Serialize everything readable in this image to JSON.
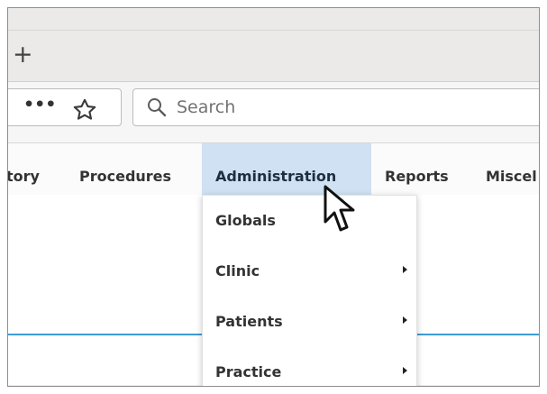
{
  "browser": {
    "new_tab_label": "+",
    "more_label": "•••",
    "search": {
      "placeholder": "Search",
      "value": ""
    }
  },
  "nav": {
    "items": [
      {
        "label": "tory"
      },
      {
        "label": "Procedures"
      },
      {
        "label": "Administration",
        "active": true
      },
      {
        "label": "Reports"
      },
      {
        "label": "Miscel"
      }
    ]
  },
  "menu": {
    "items": [
      {
        "label": "Globals",
        "has_submenu": false
      },
      {
        "label": "Clinic",
        "has_submenu": true
      },
      {
        "label": "Patients",
        "has_submenu": true
      },
      {
        "label": "Practice",
        "has_submenu": true
      }
    ]
  },
  "colors": {
    "active_nav_bg": "#cfe1f3",
    "accent_rule": "#3d9bd5",
    "text": "#333333"
  },
  "icons": {
    "more": "ellipsis-icon",
    "bookmark": "star-icon",
    "search": "search-icon",
    "submenu": "chevron-right-icon",
    "cursor": "mouse-pointer-icon"
  }
}
